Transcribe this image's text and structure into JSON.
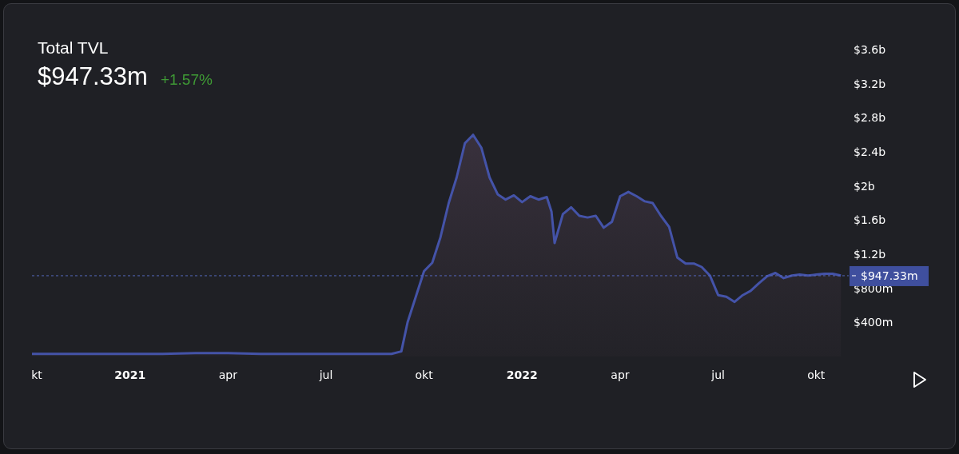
{
  "header": {
    "value": "$947.33m",
    "change": "+1.57%"
  },
  "chart_data": {
    "type": "area",
    "title": "Total TVL",
    "xlim": [
      2020.75,
      2022.833
    ],
    "ylim": [
      0,
      3600000000
    ],
    "xticks": [
      {
        "value": 2020.75,
        "label": "kt"
      },
      {
        "value": 2021,
        "label": "2021"
      },
      {
        "value": 2021.25,
        "label": "apr"
      },
      {
        "value": 2021.5,
        "label": "jul"
      },
      {
        "value": 2021.75,
        "label": "okt"
      },
      {
        "value": 2022,
        "label": "2022"
      },
      {
        "value": 2022.25,
        "label": "apr"
      },
      {
        "value": 2022.5,
        "label": "jul"
      },
      {
        "value": 2022.75,
        "label": "okt"
      }
    ],
    "yticks": [
      {
        "value": 400000000,
        "label": "$400m"
      },
      {
        "value": 800000000,
        "label": "$800m"
      },
      {
        "value": 1200000000,
        "label": "$1.2b"
      },
      {
        "value": 1600000000,
        "label": "$1.6b"
      },
      {
        "value": 2000000000,
        "label": "$2b"
      },
      {
        "value": 2400000000,
        "label": "$2.4b"
      },
      {
        "value": 2800000000,
        "label": "$2.8b"
      },
      {
        "value": 3200000000,
        "label": "$3.2b"
      },
      {
        "value": 3600000000,
        "label": "$3.6b"
      }
    ],
    "x": [
      2020.75,
      2020.833,
      2020.917,
      2021,
      2021.083,
      2021.167,
      2021.25,
      2021.333,
      2021.417,
      2021.5,
      2021.583,
      2021.667,
      2021.692,
      2021.708,
      2021.729,
      2021.75,
      2021.771,
      2021.792,
      2021.813,
      2021.833,
      2021.854,
      2021.875,
      2021.896,
      2021.917,
      2021.938,
      2021.958,
      2021.979,
      2022,
      2022.021,
      2022.042,
      2022.063,
      2022.075,
      2022.083,
      2022.104,
      2022.125,
      2022.146,
      2022.167,
      2022.188,
      2022.208,
      2022.229,
      2022.25,
      2022.271,
      2022.292,
      2022.313,
      2022.333,
      2022.354,
      2022.375,
      2022.396,
      2022.417,
      2022.438,
      2022.458,
      2022.479,
      2022.5,
      2022.521,
      2022.542,
      2022.563,
      2022.583,
      2022.604,
      2022.625,
      2022.646,
      2022.667,
      2022.688,
      2022.708,
      2022.729,
      2022.75,
      2022.771,
      2022.792,
      2022.813
    ],
    "series": [
      {
        "color": "#4453a8",
        "values": [
          30000000,
          30000000,
          30000000,
          30000000,
          30000000,
          40000000,
          40000000,
          30000000,
          30000000,
          30000000,
          30000000,
          30000000,
          60000000,
          400000000,
          700000000,
          1000000000,
          1100000000,
          1400000000,
          1800000000,
          2100000000,
          2500000000,
          2600000000,
          2450000000,
          2100000000,
          1900000000,
          1840000000,
          1890000000,
          1810000000,
          1880000000,
          1840000000,
          1870000000,
          1700000000,
          1330000000,
          1670000000,
          1750000000,
          1650000000,
          1630000000,
          1650000000,
          1510000000,
          1580000000,
          1880000000,
          1930000000,
          1880000000,
          1820000000,
          1800000000,
          1650000000,
          1520000000,
          1160000000,
          1090000000,
          1090000000,
          1050000000,
          950000000,
          720000000,
          700000000,
          640000000,
          720000000,
          770000000,
          860000000,
          940000000,
          980000000,
          920000000,
          950000000,
          960000000,
          950000000,
          960000000,
          970000000,
          970000000,
          950000000
        ]
      }
    ],
    "ref_lines": [
      {
        "axis": "y",
        "value": 947330000,
        "label": "$947.33m"
      }
    ]
  }
}
